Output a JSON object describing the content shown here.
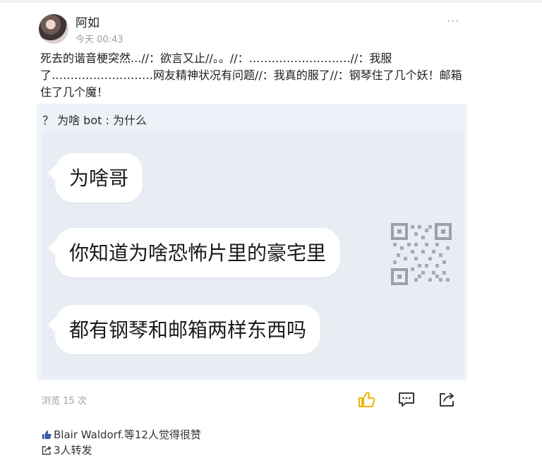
{
  "post": {
    "author": "阿如",
    "time": "今天 00:43",
    "more_label": "···",
    "text": "死去的谐音梗突然...//：欲言又止//。。//：………………………//：我服了………………………网友精神状况有问题//：我真的服了//：钢琴住了几个妖！邮箱住了几个魔！"
  },
  "shared": {
    "title": "？ 为啥 bot : 为什么",
    "bubbles": [
      "为啥哥",
      "你知道为啥恐怖片里的豪宅里",
      "都有钢琴和邮箱两样东西吗"
    ]
  },
  "stats": {
    "views": "浏览 15 次",
    "likes": "Blair Waldorf.等12人觉得很赞",
    "forwards": "3人转发"
  },
  "colors": {
    "like_icon": "#f2b400",
    "icon_gray": "#3a3a3a",
    "card_bg": "#eef2f8"
  },
  "icons": [
    "like-icon",
    "comment-icon",
    "share-icon",
    "qr-code"
  ]
}
